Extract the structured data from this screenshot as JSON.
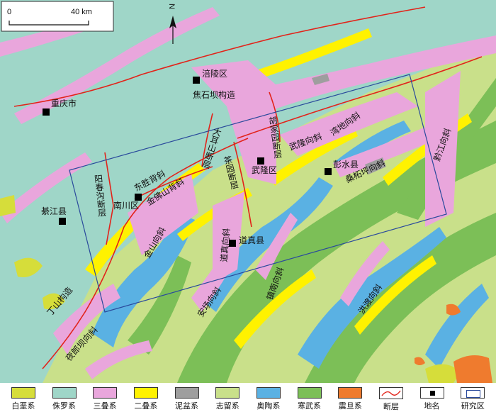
{
  "map": {
    "north_label": "N",
    "scale_zero": "0",
    "scale_end": "40 km",
    "places": [
      {
        "name": "涪陵区"
      },
      {
        "name": "重庆市"
      },
      {
        "name": "武隆区"
      },
      {
        "name": "彭水县"
      },
      {
        "name": "南川区"
      },
      {
        "name": "綦江县"
      },
      {
        "name": "道真县"
      }
    ],
    "structures": [
      {
        "name": "焦石坝构造"
      },
      {
        "name": "大耳山断层"
      },
      {
        "name": "胡家园断层"
      },
      {
        "name": "武隆向斜"
      },
      {
        "name": "湾地向斜"
      },
      {
        "name": "桑柘坪向斜"
      },
      {
        "name": "黔江向斜"
      },
      {
        "name": "阳春沟断层"
      },
      {
        "name": "东胜背斜"
      },
      {
        "name": "金佛山背斜"
      },
      {
        "name": "金山向斜"
      },
      {
        "name": "安场向斜"
      },
      {
        "name": "道真向斜"
      },
      {
        "name": "茶园断层"
      },
      {
        "name": "镇南向斜"
      },
      {
        "name": "洪渡向斜"
      },
      {
        "name": "丁山构造"
      },
      {
        "name": "夜郎坝向斜"
      }
    ]
  },
  "legend": [
    {
      "label": "白垩系",
      "color": "#d6dd3a",
      "kind": "fill"
    },
    {
      "label": "侏罗系",
      "color": "#9fd6c8",
      "kind": "fill"
    },
    {
      "label": "三叠系",
      "color": "#e9a6dc",
      "kind": "fill"
    },
    {
      "label": "二叠系",
      "color": "#fff200",
      "kind": "fill"
    },
    {
      "label": "泥盆系",
      "color": "#9e9e9e",
      "kind": "fill"
    },
    {
      "label": "志留系",
      "color": "#c9e08a",
      "kind": "fill"
    },
    {
      "label": "奥陶系",
      "color": "#5ab1e3",
      "kind": "fill"
    },
    {
      "label": "寒武系",
      "color": "#7cbf57",
      "kind": "fill"
    },
    {
      "label": "震旦系",
      "color": "#ef7b2e",
      "kind": "fill"
    },
    {
      "label": "断层",
      "color": "#e2231a",
      "kind": "fault"
    },
    {
      "label": "地名",
      "color": "#000000",
      "kind": "place"
    },
    {
      "label": "研究区",
      "color": "#2a4a9c",
      "kind": "area"
    }
  ]
}
